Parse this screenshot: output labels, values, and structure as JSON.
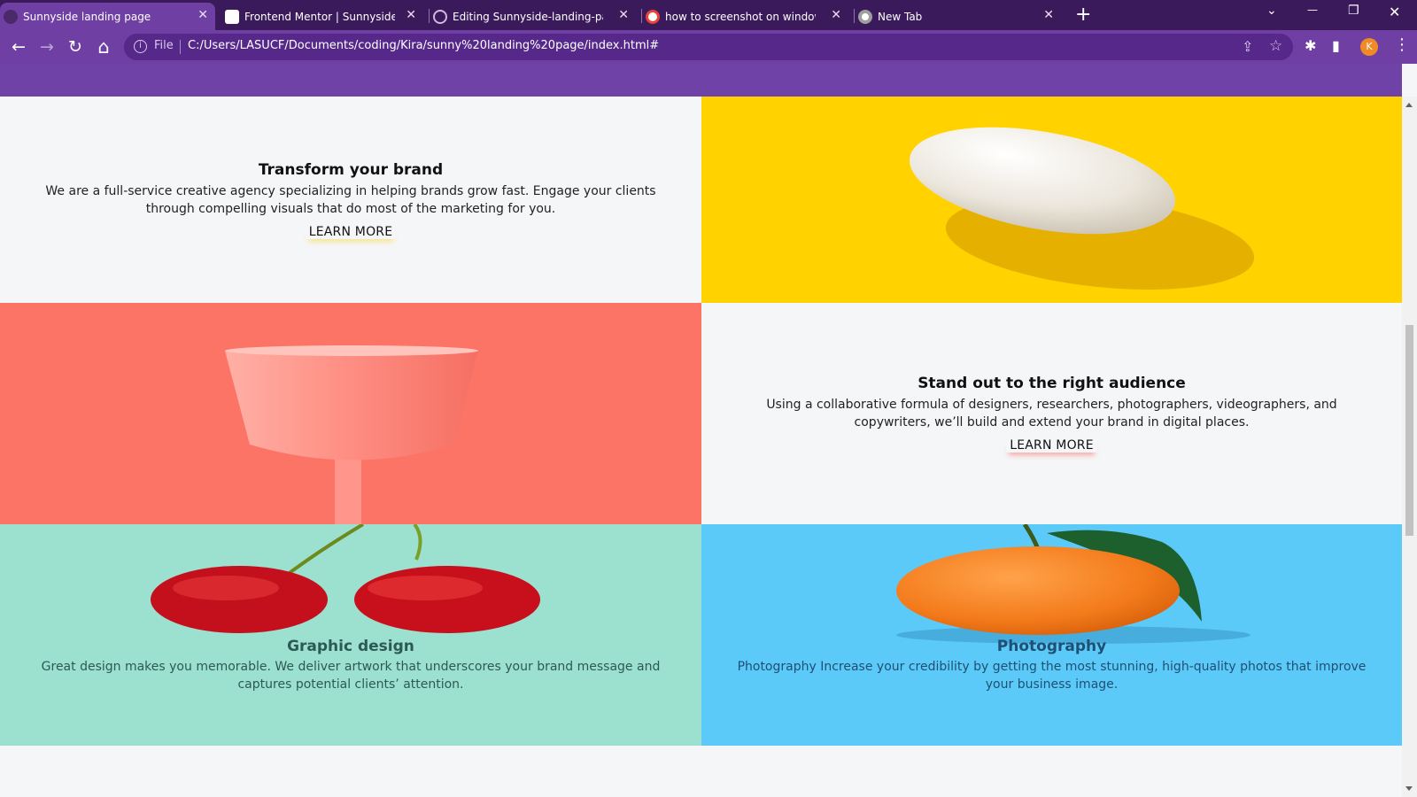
{
  "browser": {
    "tabs": [
      {
        "title": "Sunnyside landing page",
        "active": true,
        "favicon": "globe-icon"
      },
      {
        "title": "Frontend Mentor | Sunnyside ag",
        "active": false,
        "favicon": "frontend-mentor-icon"
      },
      {
        "title": "Editing Sunnyside-landing-page",
        "active": false,
        "favicon": "github-icon"
      },
      {
        "title": "how to screenshot on windows",
        "active": false,
        "favicon": "google-icon"
      },
      {
        "title": "New Tab",
        "active": false,
        "favicon": "chrome-icon"
      }
    ],
    "omnibox": {
      "scheme_label": "File",
      "url": "C:/Users/LASUCF/Documents/coding/Kira/sunny%20landing%20page/index.html#"
    },
    "profile_initial": "K",
    "icons": {
      "back": "←",
      "forward": "→",
      "reload": "↻",
      "home": "⌂",
      "newtab": "+",
      "tabsearch": "⌄",
      "minimize": "—",
      "restore": "❐",
      "close": "✕",
      "share": "⇪",
      "star": "☆",
      "extensions": "✱",
      "sidepanel": "▮",
      "menu": "⋮",
      "info": "i",
      "tabclose": "✕"
    }
  },
  "page": {
    "colors": {
      "band": "#6f42a8",
      "egg_bg": "#ffd200",
      "cup_bg": "#fb7466",
      "cherry_bg": "#9ce0d0",
      "orange_bg": "#5ccaf9"
    },
    "transform": {
      "heading": "Transform your brand",
      "body": "We are a full-service creative agency specializing in helping brands grow fast. Engage your clients through compelling visuals that do most of the marketing for you.",
      "link": "LEARN MORE"
    },
    "standout": {
      "heading": "Stand out to the right audience",
      "body": "Using a collaborative formula of designers, researchers, photographers, videographers, and copywriters, we’ll build and extend your brand in digital places.",
      "link": "LEARN MORE"
    },
    "graphic": {
      "heading": "Graphic design",
      "body": "Great design makes you memorable. We deliver artwork that underscores your brand message and captures potential clients’ attention."
    },
    "photography": {
      "heading": "Photography",
      "body": "Photography Increase your credibility by getting the most stunning, high-quality photos that improve your business image."
    }
  }
}
